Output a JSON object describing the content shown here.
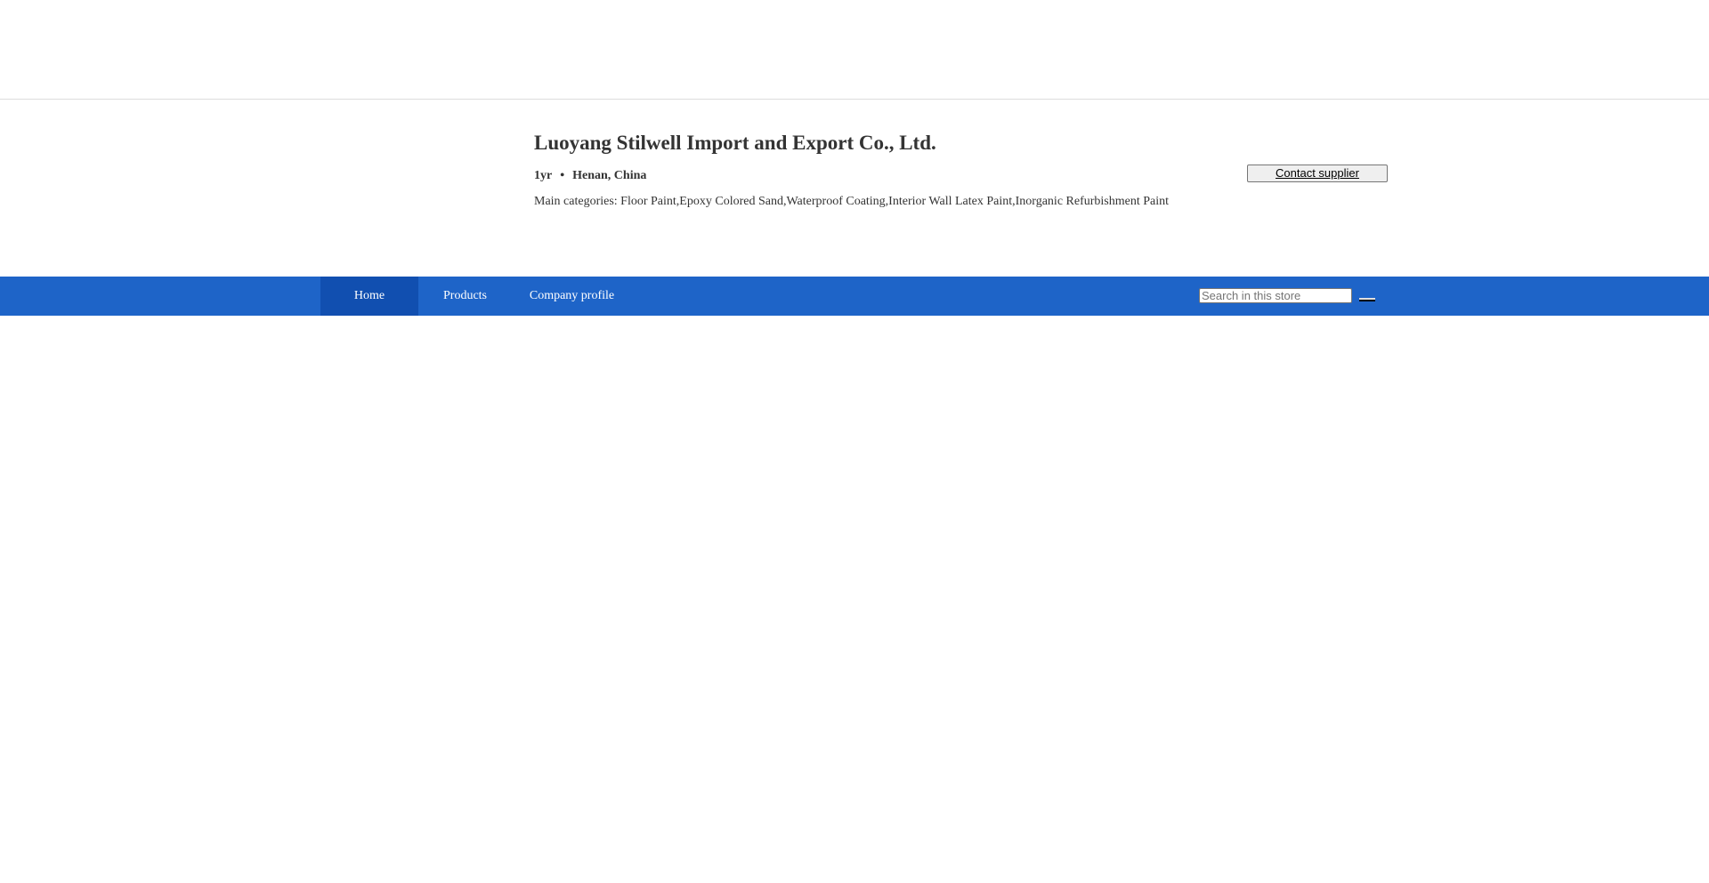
{
  "company": {
    "name": "Luoyang Stilwell Import and Export Co., Ltd.",
    "years": "1yr",
    "separator": "•",
    "location": "Henan, China",
    "main_categories": "Main categories: Floor Paint,Epoxy Colored Sand,Waterproof Coating,Interior Wall Latex Paint,Inorganic Refurbishment Paint",
    "contact_label": "Contact supplier"
  },
  "nav": {
    "items": [
      {
        "label": "Home",
        "active": true
      },
      {
        "label": "Products",
        "active": false
      },
      {
        "label": "Company profile",
        "active": false
      }
    ],
    "search_placeholder": "Search in this store",
    "search_value": ""
  },
  "colors": {
    "nav_background": "#1e64c8",
    "nav_active": "#114fb0",
    "text": "#333333"
  }
}
